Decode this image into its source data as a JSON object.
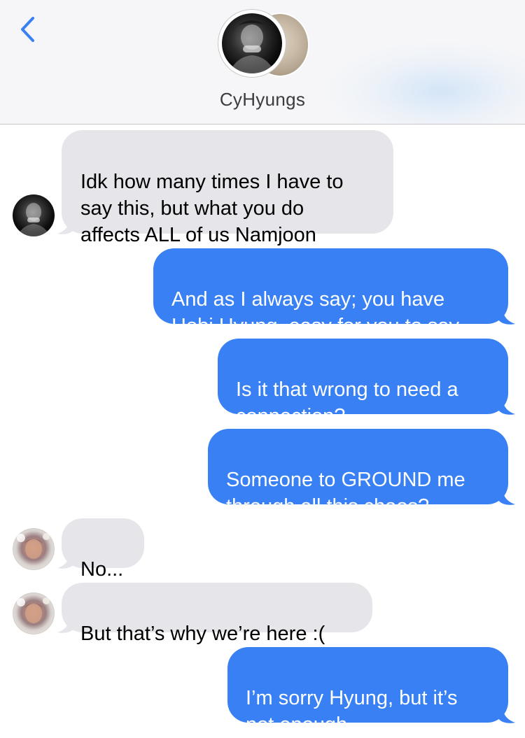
{
  "header": {
    "group_name": "CyHyungs",
    "back_icon": "chevron-left-icon",
    "accent_color": "#3880f3"
  },
  "messages": [
    {
      "direction": "incoming",
      "text": "Idk how many times I have to\nsay this, but what you do\naffects ALL of us Namjoon"
    },
    {
      "direction": "outgoing",
      "text": "And as I always say; you have\nHobi Hyung, easy for you to say"
    },
    {
      "direction": "outgoing",
      "text": "Is it that wrong to need a\nconnection?"
    },
    {
      "direction": "outgoing",
      "text": "Someone to GROUND me\nthrough all this chaos?"
    },
    {
      "direction": "incoming",
      "text": "No..."
    },
    {
      "direction": "incoming",
      "text": "But that’s why we’re here :("
    },
    {
      "direction": "outgoing",
      "text": "I’m sorry Hyung, but it’s\nnot enough"
    }
  ],
  "colors": {
    "incoming_bubble": "#e5e5ea",
    "outgoing_bubble": "#3880f3",
    "header_background": "#f6f6f8"
  }
}
